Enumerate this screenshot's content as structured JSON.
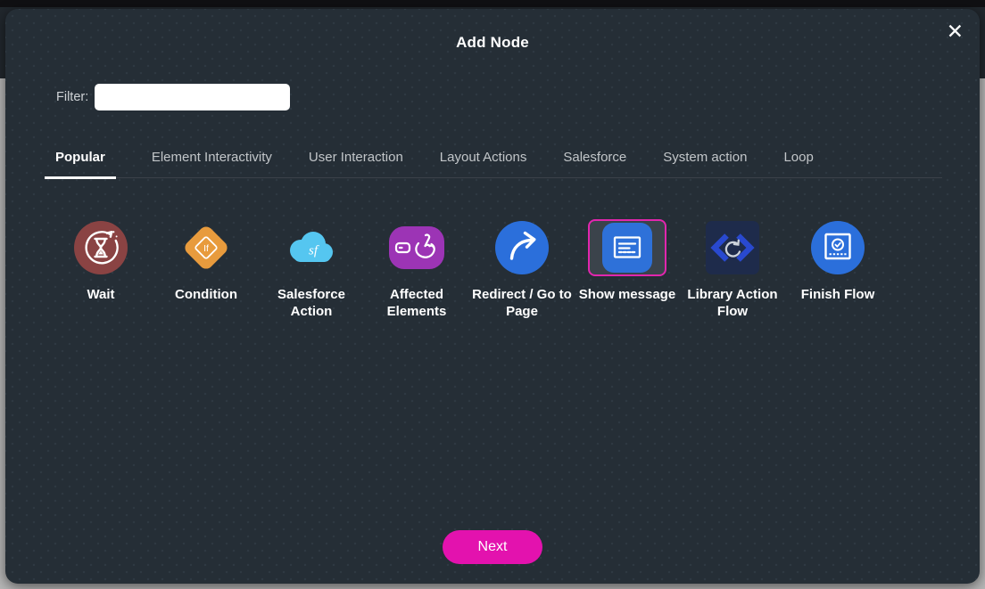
{
  "modal": {
    "title": "Add Node",
    "close_icon": "✕"
  },
  "filter": {
    "label": "Filter:",
    "value": ""
  },
  "tabs": [
    {
      "label": "Popular",
      "active": true
    },
    {
      "label": "Element Interactivity",
      "active": false
    },
    {
      "label": "User Interaction",
      "active": false
    },
    {
      "label": "Layout Actions",
      "active": false
    },
    {
      "label": "Salesforce",
      "active": false
    },
    {
      "label": "System action",
      "active": false
    },
    {
      "label": "Loop",
      "active": false
    }
  ],
  "nodes": [
    {
      "label": "Wait",
      "icon": "wait-icon",
      "selected": false
    },
    {
      "label": "Condition",
      "icon": "condition-icon",
      "selected": false,
      "glyph_text": "If"
    },
    {
      "label": "Salesforce Action",
      "icon": "salesforce-cloud-icon",
      "selected": false,
      "glyph_text": "sf"
    },
    {
      "label": "Affected Elements",
      "icon": "affected-elements-hand-icon",
      "selected": false
    },
    {
      "label": "Redirect / Go to Page",
      "icon": "redirect-arrow-icon",
      "selected": false
    },
    {
      "label": "Show message",
      "icon": "show-message-icon",
      "selected": true
    },
    {
      "label": "Library Action Flow",
      "icon": "library-action-flow-icon",
      "selected": false
    },
    {
      "label": "Finish Flow",
      "icon": "finish-flow-icon",
      "selected": false
    }
  ],
  "footer": {
    "next_label": "Next"
  },
  "colors": {
    "modal_bg": "#252e36",
    "accent_pink": "#e312ae",
    "selection_border": "#e226ae",
    "node_blue": "#2b6fdb",
    "condition_orange": "#e89b3d",
    "wait_maroon": "#8a4343",
    "affected_purple": "#9c34b5",
    "cloud_blue": "#55c6f0",
    "library_navy": "#1e2b4b"
  }
}
